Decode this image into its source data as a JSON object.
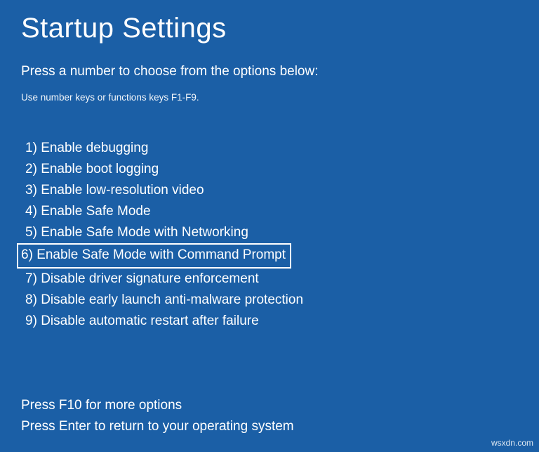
{
  "title": "Startup Settings",
  "subtitle": "Press a number to choose from the options below:",
  "hint": "Use number keys or functions keys F1-F9.",
  "options": [
    {
      "num": "1",
      "label": "Enable debugging",
      "highlighted": false
    },
    {
      "num": "2",
      "label": "Enable boot logging",
      "highlighted": false
    },
    {
      "num": "3",
      "label": "Enable low-resolution video",
      "highlighted": false
    },
    {
      "num": "4",
      "label": "Enable Safe Mode",
      "highlighted": false
    },
    {
      "num": "5",
      "label": "Enable Safe Mode with Networking",
      "highlighted": false
    },
    {
      "num": "6",
      "label": "Enable Safe Mode with Command Prompt",
      "highlighted": true
    },
    {
      "num": "7",
      "label": "Disable driver signature enforcement",
      "highlighted": false
    },
    {
      "num": "8",
      "label": "Disable early launch anti-malware protection",
      "highlighted": false
    },
    {
      "num": "9",
      "label": "Disable automatic restart after failure",
      "highlighted": false
    }
  ],
  "footer": {
    "more": "Press F10 for more options",
    "return": "Press Enter to return to your operating system"
  },
  "watermark": "wsxdn.com"
}
